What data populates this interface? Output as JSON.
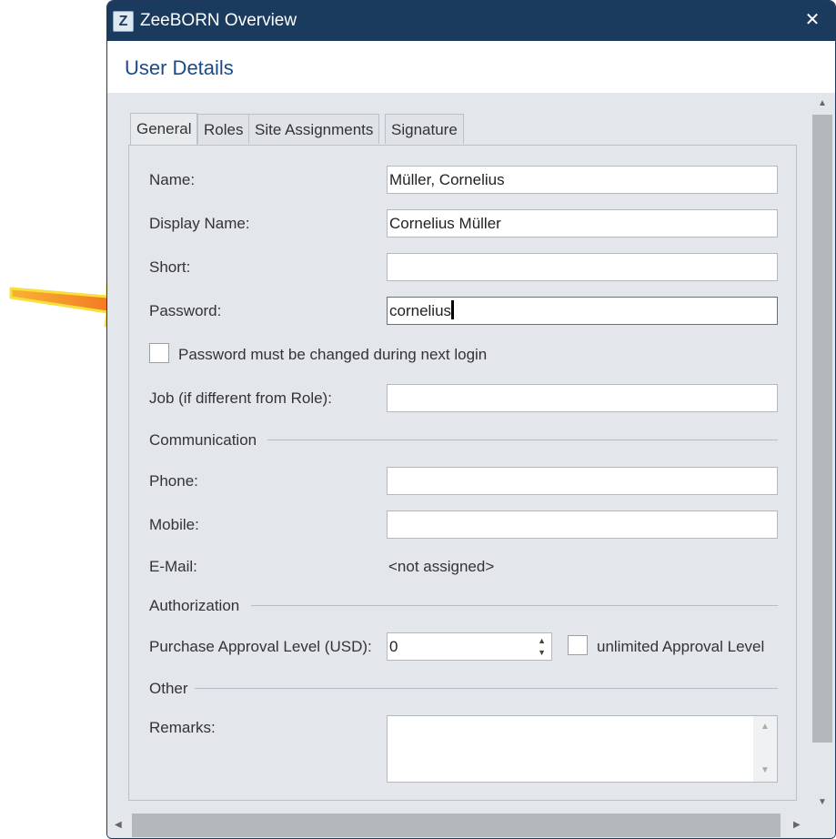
{
  "window": {
    "title": "ZeeBORN Overview",
    "logo": "Z",
    "close": "✕"
  },
  "header": {
    "title": "User Details"
  },
  "tabs": [
    {
      "label": "General",
      "active": true
    },
    {
      "label": "Roles",
      "active": false
    },
    {
      "label": "Site Assignments",
      "active": false
    },
    {
      "label": "Signature",
      "active": false
    }
  ],
  "form": {
    "name_label": "Name:",
    "name_value": "Müller, Cornelius",
    "display_name_label": "Display Name:",
    "display_name_value": "Cornelius Müller",
    "short_label": "Short:",
    "short_value": "",
    "password_label": "Password:",
    "password_value": "cornelius",
    "password_change_label": "Password must be changed during next login",
    "password_change_checked": false,
    "job_label": "Job (if different from Role):",
    "job_value": "",
    "communication_group": "Communication",
    "phone_label": "Phone:",
    "phone_value": "",
    "mobile_label": "Mobile:",
    "mobile_value": "",
    "email_label": "E-Mail:",
    "email_value": "<not assigned>",
    "authorization_group": "Authorization",
    "approval_label": "Purchase Approval Level (USD):",
    "approval_value": "0",
    "unlimited_label": "unlimited Approval Level",
    "unlimited_checked": false,
    "other_group": "Other",
    "remarks_label": "Remarks:",
    "remarks_value": ""
  },
  "icons": {
    "spin_up": "▲",
    "spin_down": "▼",
    "scroll_up": "▲",
    "scroll_down": "▼",
    "scroll_left": "◀",
    "scroll_right": "▶"
  },
  "colors": {
    "titlebar": "#1a3a5e",
    "header_title": "#1a4a8a",
    "arrow": "#f97a1a"
  }
}
